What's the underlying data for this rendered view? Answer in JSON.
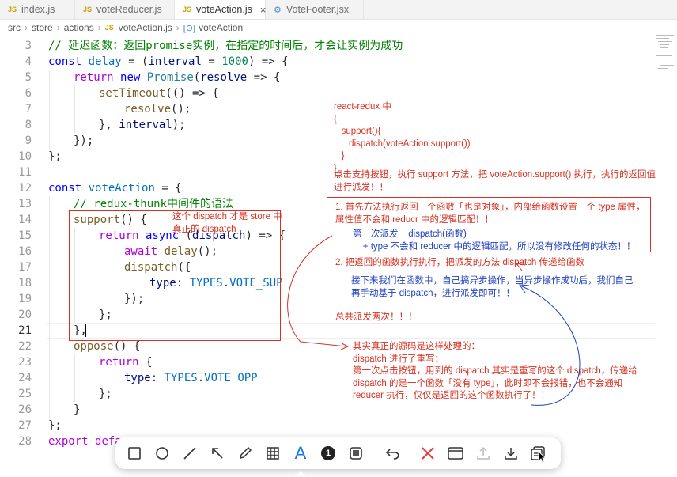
{
  "tabs": [
    {
      "badge": "JS",
      "label": "index.js"
    },
    {
      "badge": "JS",
      "label": "voteReducer.js"
    },
    {
      "badge": "JS",
      "label": "voteAction.js",
      "close": "×"
    },
    {
      "badge": "⚙",
      "label": "VoteFooter.jsx"
    }
  ],
  "breadcrumb": {
    "items": [
      "src",
      "store",
      "actions"
    ],
    "file_badge": "JS",
    "file": "voteAction.js",
    "symbol_badge": "[⊙]",
    "symbol": "voteAction"
  },
  "code": {
    "line_numbers": [
      "3",
      "4",
      "5",
      "6",
      "7",
      "8",
      "9",
      "10",
      "11",
      "12",
      "13",
      "14",
      "15",
      "16",
      "17",
      "18",
      "19",
      "20",
      "21",
      "22",
      "23",
      "24",
      "25",
      "26",
      "27",
      "28"
    ],
    "l3": "// 延迟函数：返回promise实例，在指定的时间后，才会让实例为成功",
    "l4": [
      "const",
      "delay",
      "= (",
      "interval",
      "=",
      "1000",
      ") => {"
    ],
    "l5": [
      "return",
      "new",
      "Promise",
      "(",
      "resolve",
      "=> {"
    ],
    "l6": [
      "setTimeout",
      "(() => {"
    ],
    "l7": [
      "resolve",
      "();"
    ],
    "l8": [
      "}, ",
      "interval",
      ");"
    ],
    "l9": "});",
    "l10": "};",
    "l12": [
      "const",
      "voteAction",
      "= {"
    ],
    "l13": "// redux-thunk中间件的语法",
    "l14": [
      "support",
      "() {"
    ],
    "l15": [
      "return",
      "async",
      "(",
      "dispatch",
      ") => {"
    ],
    "l16": [
      "await",
      "delay",
      "();"
    ],
    "l17": [
      "dispatch",
      "({"
    ],
    "l18": [
      "type",
      ": ",
      "TYPES",
      ".",
      "VOTE_SUP"
    ],
    "l19": "});",
    "l20": "};",
    "l21": "},",
    "l22": [
      "oppose",
      "() {"
    ],
    "l23": [
      "return",
      "{"
    ],
    "l24": [
      "type",
      ": ",
      "TYPES",
      ".",
      "VOTE_OPP"
    ],
    "l25": "};",
    "l26": "}",
    "l27": "};",
    "l28": [
      "export",
      "defau"
    ]
  },
  "annotations": {
    "a1": "react-redux 中\n{\n   support(){\n      dispatch(voteAction.support())\n   }\n}",
    "a2": "点击支持按钮，执行 support 方法，把 voteAction.support() 执行，执行的返回值\n进行派发！！",
    "a3": "1. 首先方法执行返回一个函数「也是对象」，内部给函数设置一个 type 属性，\n属性值不会和 reducr 中的逻辑匹配！！",
    "a4": "第一次派发    dispatch(函数)\n    + type 不会和 reducer 中的逻辑匹配，所以没有修改任何的状态！！",
    "a5": "2. 把返回的函数执行执行，把派发的方法 dispatch 传递给函数",
    "a6": "接下来我们在函数中，自己搞异步操作，当异步操作成功后，我们自己\n再手动基于 dispatch，进行派发即可！！",
    "a7": "总共派发两次！！！",
    "a8": "这个 dispatch 才是 store 中\n真正的 dispatch",
    "a9": "其实真正的源码是这样处理的：\ndispatch 进行了重写：\n第一次点击按钮，用到的 dispatch 其实是重写的这个 dispatch，传递给\ndispatch 的是一个函数「没有 type」，此时即不会报错，也不会通知\nreducer 执行，仅仅是返回的这个函数执行了！！"
  },
  "toolbar": {
    "tools": [
      "rectangle-tool",
      "ellipse-tool",
      "line-tool",
      "arrow-tool",
      "pen-tool",
      "mosaic-tool",
      "text-tool",
      "number-tool",
      "border-tool",
      "undo-tool",
      "cancel-tool",
      "pin-tool",
      "upload-tool",
      "download-tool",
      "copy-tool"
    ],
    "text_tool_glyph": "A",
    "number_tool_glyph": "1"
  },
  "colors": {
    "annotation_red": "#d83020",
    "annotation_blue": "#2040c0",
    "text_tool_active": "#1a73e8",
    "cancel": "#e53935"
  }
}
